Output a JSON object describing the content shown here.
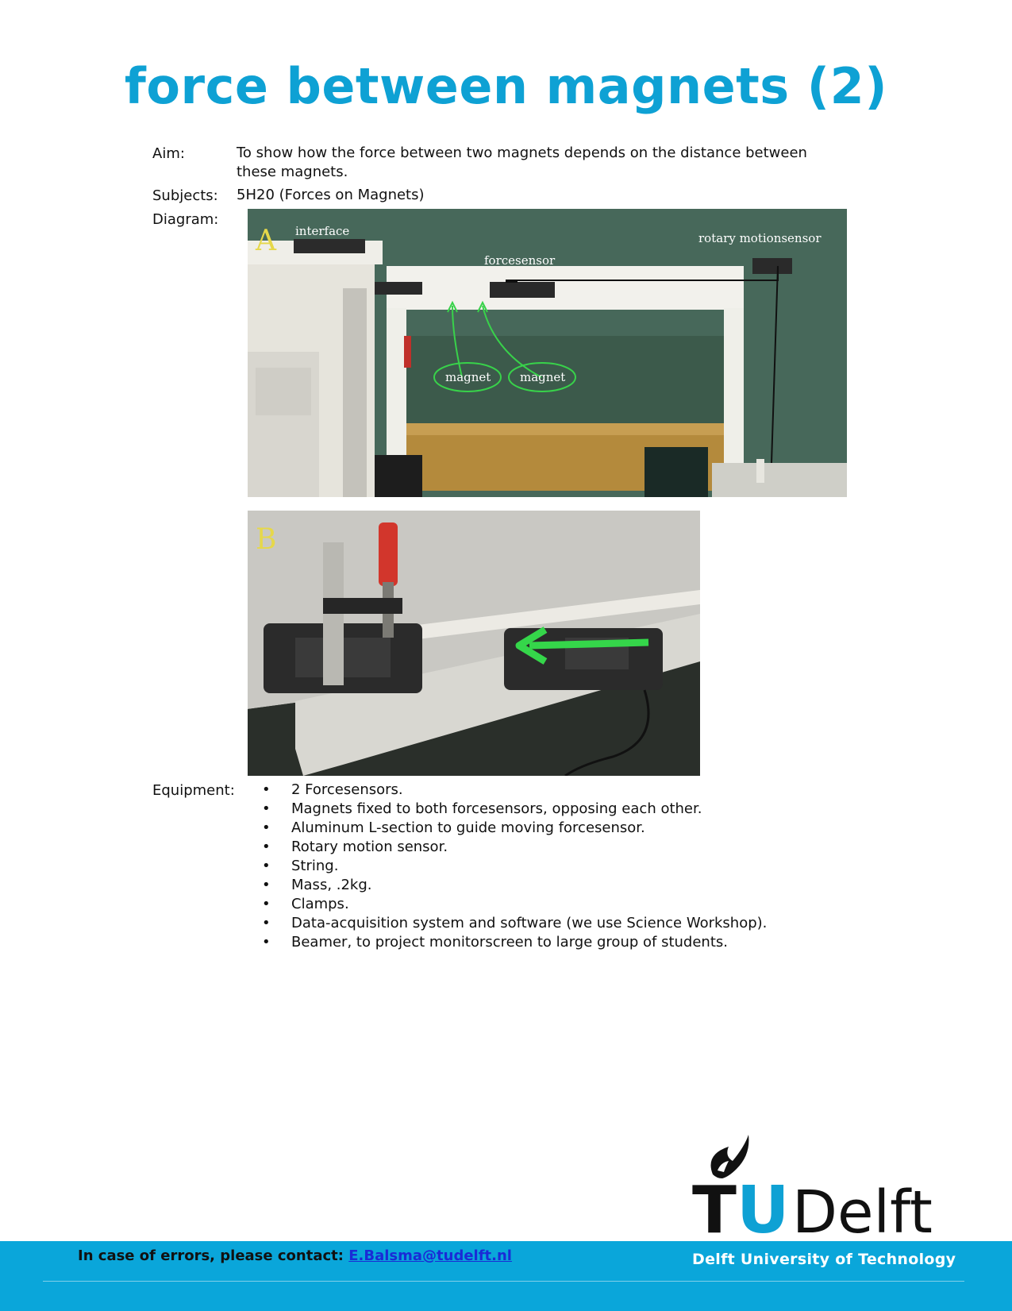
{
  "title": "force between magnets (2)",
  "aim": {
    "label": "Aim:",
    "text": "To show how the force between two magnets depends on the distance between these magnets."
  },
  "subjects": {
    "label": "Subjects:",
    "text": "5H20 (Forces on Magnets)"
  },
  "diagram": {
    "label": "Diagram:",
    "photo_a": {
      "letter": "A",
      "labels": {
        "interface": "interface",
        "forcesensor": "forcesensor",
        "rotary": "rotary motionsensor",
        "magnet_left": "magnet",
        "magnet_right": "magnet"
      }
    },
    "photo_b": {
      "letter": "B"
    }
  },
  "equipment": {
    "label": "Equipment:",
    "items": [
      "2 Forcesensors.",
      "Magnets fixed to both forcesensors, opposing each other.",
      "Aluminum L-section to guide moving forcesensor.",
      "Rotary motion sensor.",
      "String.",
      "Mass, .2kg.",
      "Clamps.",
      "Data-acquisition system and software (we use Science Workshop).",
      "Beamer, to project monitorscreen to large group of students."
    ]
  },
  "logo": {
    "tu": "TU",
    "delft": "Delft"
  },
  "footer": {
    "contact_text": "In case of errors, please contact:",
    "contact_email": "E.Balsma@tudelft.nl",
    "university": "Delft University of Technology"
  },
  "colors": {
    "title": "#0ea1d4",
    "footer": "#0aa6da",
    "logo_u": "#0ea1d4",
    "link": "#1a2bd6"
  }
}
